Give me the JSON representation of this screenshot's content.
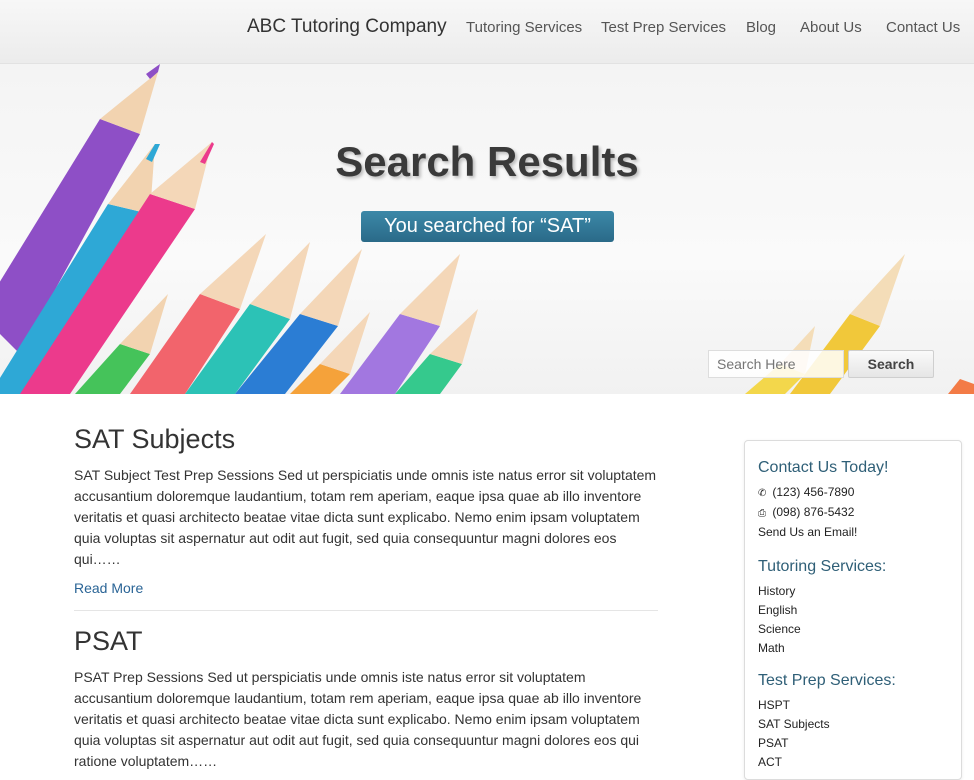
{
  "nav": {
    "brand": "ABC Tutoring Company",
    "links": [
      "Tutoring Services",
      "Test Prep Services",
      "Blog",
      "About Us",
      "Contact Us"
    ]
  },
  "hero": {
    "title": "Search Results",
    "badge": "You searched for “SAT”",
    "search_placeholder": "Search Here",
    "search_button": "Search"
  },
  "results": [
    {
      "title": "SAT Subjects",
      "excerpt": "SAT Subject Test Prep Sessions Sed ut perspiciatis unde omnis iste natus error sit voluptatem accusantium doloremque laudantium, totam rem aperiam, eaque ipsa quae ab illo inventore veritatis et quasi architecto beatae vitae dicta sunt explicabo. Nemo enim ipsam voluptatem quia voluptas sit aspernatur aut odit aut fugit, sed quia consequuntur magni dolores eos qui……",
      "read_more": "Read More"
    },
    {
      "title": "PSAT",
      "excerpt": "PSAT Prep Sessions Sed ut perspiciatis unde omnis iste natus error sit voluptatem accusantium doloremque laudantium, totam rem aperiam, eaque ipsa quae ab illo inventore veritatis et quasi architecto beatae vitae dicta sunt explicabo. Nemo enim ipsam voluptatem quia voluptas sit aspernatur aut odit aut fugit, sed quia consequuntur magni dolores eos qui ratione voluptatem……"
    }
  ],
  "sidebar": {
    "contact_heading": "Contact Us Today!",
    "phone": "(123) 456-7890",
    "fax": "(098) 876-5432",
    "email_link": "Send Us an Email!",
    "tutoring_heading": "Tutoring Services:",
    "tutoring_items": [
      "History",
      "English",
      "Science",
      "Math"
    ],
    "testprep_heading": "Test Prep Services:",
    "testprep_items": [
      "HSPT",
      "SAT Subjects",
      "PSAT",
      "ACT"
    ]
  },
  "colors": {
    "accent": "#2f5f77",
    "badge": "#2f7596",
    "link": "#2a6496"
  }
}
